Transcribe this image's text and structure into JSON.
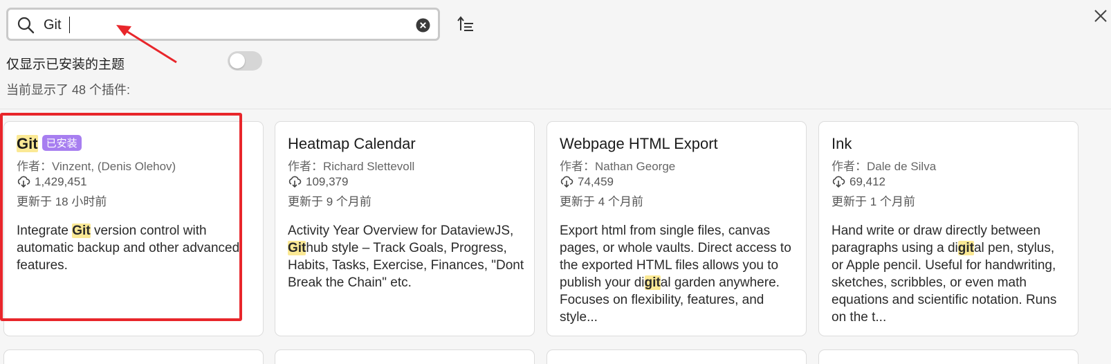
{
  "search": {
    "value": "Git",
    "placeholder": ""
  },
  "filter": {
    "installed_only_label": "仅显示已安装的主题",
    "installed_only_on": false
  },
  "count_text": "当前显示了 48 个插件:",
  "icons": {
    "search": "search-icon",
    "clear": "clear-circle-x-icon",
    "sort": "sort-icon",
    "close": "close-icon",
    "download": "download-cloud-icon"
  },
  "colors": {
    "highlight": "#fbe995",
    "badge": "#a77ef0",
    "annotation": "#e8262b"
  },
  "plugins": [
    {
      "title": "Git",
      "badge": "已安装",
      "author": "作者：Vinzent, (Denis Olehov)",
      "downloads": "1,429,451",
      "updated": "更新于 18 小时前",
      "desc_a": "Integrate ",
      "desc_hl": "Git",
      "desc_b": " version control with automatic backup and other advanced features."
    },
    {
      "title": "Heatmap Calendar",
      "author": "作者：Richard Slettevoll",
      "downloads": "109,379",
      "updated": "更新于 9 个月前",
      "desc_a": "Activity Year Overview for DataviewJS, ",
      "desc_hl": "Git",
      "desc_b": "hub style – Track Goals, Progress, Habits, Tasks, Exercise, Finances, \"Dont Break the Chain\" etc."
    },
    {
      "title": "Webpage HTML Export",
      "author": "作者：Nathan George",
      "downloads": "74,459",
      "updated": "更新于 4 个月前",
      "desc_a": "Export html from single files, canvas pages, or whole vaults. Direct access to the exported HTML files allows you to publish your di",
      "desc_hl": "git",
      "desc_b": "al garden anywhere. Focuses on flexibility, features, and style..."
    },
    {
      "title": "Ink",
      "author": "作者：Dale de Silva",
      "downloads": "69,412",
      "updated": "更新于 1 个月前",
      "desc_a": "Hand write or draw directly between paragraphs using a di",
      "desc_hl": "git",
      "desc_b": "al pen, stylus, or Apple pencil. Useful for handwriting, sketches, scribbles, or even math equations and scientific notation. Runs on the t..."
    }
  ]
}
